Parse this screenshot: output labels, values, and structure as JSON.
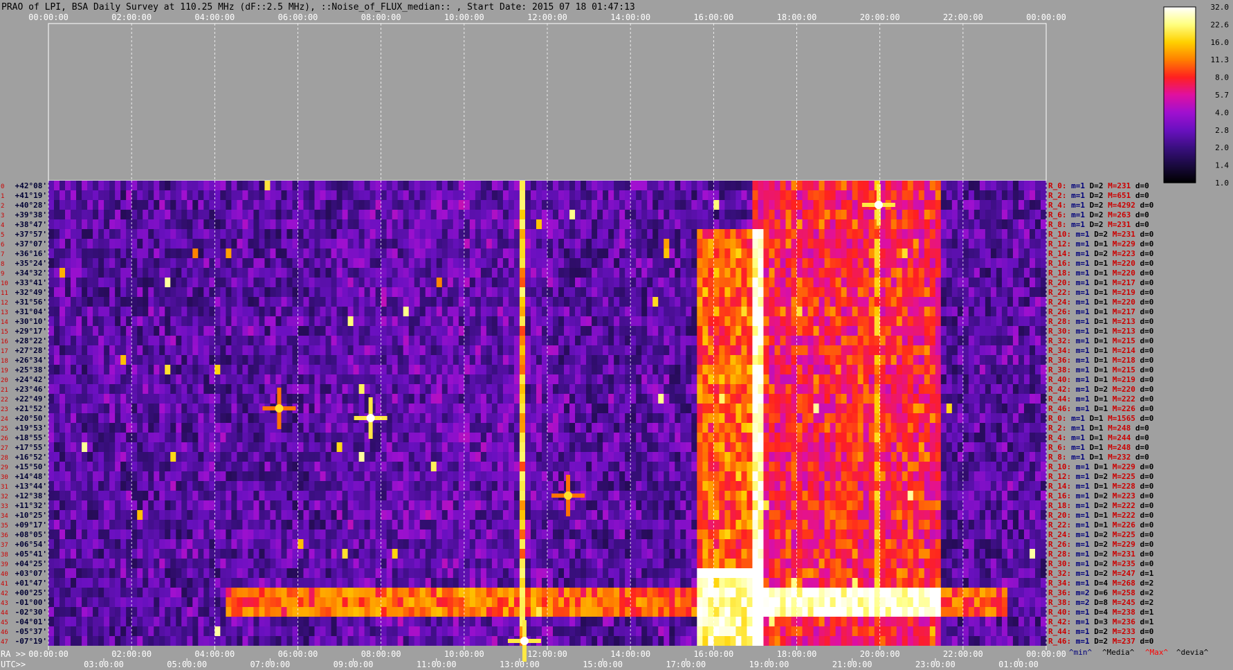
{
  "chart_data": {
    "type": "heatmap",
    "title": "PRAO of LPI, BSA Daily Survey at 110.25 MHz (dF::2.5 MHz), ::Noise_of_FLUX_median:: , Start Date: 2015 07 18 01:47:13",
    "top_time_ticks": [
      "00:00:00",
      "02:00:00",
      "04:00:00",
      "06:00:00",
      "08:00:00",
      "10:00:00",
      "12:00:00",
      "14:00:00",
      "16:00:00",
      "18:00:00",
      "20:00:00",
      "22:00:00",
      "00:00:00"
    ],
    "ra_axis_prefix": "RA >>",
    "ra_ticks": [
      "00:00:00",
      "02:00:00",
      "04:00:00",
      "06:00:00",
      "08:00:00",
      "10:00:00",
      "12:00:00",
      "14:00:00",
      "16:00:00",
      "18:00:00",
      "20:00:00",
      "22:00:00",
      "00:00:00"
    ],
    "utc_axis_prefix": "UTC>>",
    "utc_ticks": [
      "03:00:00",
      "05:00:00",
      "07:00:00",
      "09:00:00",
      "11:00:00",
      "13:00:00",
      "15:00:00",
      "17:00:00",
      "19:00:00",
      "21:00:00",
      "23:00:00",
      "01:00:00"
    ],
    "beam_indices": [
      "0",
      "1",
      "2",
      "3",
      "4",
      "5",
      "6",
      "7",
      "8",
      "9",
      "10",
      "11",
      "12",
      "13",
      "14",
      "15",
      "16",
      "17",
      "18",
      "19",
      "20",
      "21",
      "22",
      "23",
      "24",
      "25",
      "26",
      "27",
      "28",
      "29",
      "30",
      "31",
      "32",
      "33",
      "34",
      "35",
      "36",
      "37",
      "38",
      "39",
      "40",
      "41",
      "42",
      "43",
      "44",
      "45",
      "46",
      "47",
      "0",
      "1",
      "2",
      "3",
      "4",
      "5",
      "6",
      "7",
      "8",
      "9",
      "10",
      "11",
      "12",
      "13",
      "14",
      "15",
      "16",
      "17",
      "18",
      "19",
      "20",
      "21",
      "22",
      "23",
      "24",
      "25",
      "26",
      "27",
      "28",
      "29",
      "30",
      "31",
      "32",
      "33",
      "34",
      "35",
      "36",
      "37",
      "38",
      "39",
      "40",
      "41",
      "42",
      "43",
      "44",
      "45",
      "46",
      "47"
    ],
    "declinations": [
      "+42°08'",
      "+41°19'",
      "+40°28'",
      "+39°38'",
      "+38°47'",
      "+37°57'",
      "+37°07'",
      "+36°16'",
      "+35°24'",
      "+34°32'",
      "+33°41'",
      "+32°49'",
      "+31°56'",
      "+31°04'",
      "+30°10'",
      "+29°17'",
      "+28°22'",
      "+27°28'",
      "+26°34'",
      "+25°38'",
      "+24°42'",
      "+23°46'",
      "+22°49'",
      "+21°52'",
      "+20°50'",
      "+19°53'",
      "+18°55'",
      "+17°55'",
      "+16°52'",
      "+15°50'",
      "+14°48'",
      "+13°44'",
      "+12°38'",
      "+11°32'",
      "+10°25'",
      "+09°17'",
      "+08°05'",
      "+06°54'",
      "+05°41'",
      "+04°25'",
      "+03°07'",
      "+01°47'",
      "+00°25'",
      "-01°00'",
      "-02°30'",
      "-04°01'",
      "-05°37'",
      "-07°19'"
    ],
    "row_stats": [
      {
        "label": "R_0:",
        "m": "1",
        "D": "2",
        "M": "231",
        "d": "0"
      },
      {
        "label": "R_2:",
        "m": "1",
        "D": "2",
        "M": "651",
        "d": "0"
      },
      {
        "label": "R_4:",
        "m": "1",
        "D": "2",
        "M": "4292",
        "d": "0"
      },
      {
        "label": "R_6:",
        "m": "1",
        "D": "2",
        "M": "263",
        "d": "0"
      },
      {
        "label": "R_8:",
        "m": "1",
        "D": "2",
        "M": "231",
        "d": "0"
      },
      {
        "label": "R_10:",
        "m": "1",
        "D": "2",
        "M": "231",
        "d": "0"
      },
      {
        "label": "R_12:",
        "m": "1",
        "D": "1",
        "M": "229",
        "d": "0"
      },
      {
        "label": "R_14:",
        "m": "1",
        "D": "2",
        "M": "223",
        "d": "0"
      },
      {
        "label": "R_16:",
        "m": "1",
        "D": "1",
        "M": "220",
        "d": "0"
      },
      {
        "label": "R_18:",
        "m": "1",
        "D": "1",
        "M": "220",
        "d": "0"
      },
      {
        "label": "R_20:",
        "m": "1",
        "D": "1",
        "M": "217",
        "d": "0"
      },
      {
        "label": "R_22:",
        "m": "1",
        "D": "1",
        "M": "219",
        "d": "0"
      },
      {
        "label": "R_24:",
        "m": "1",
        "D": "1",
        "M": "220",
        "d": "0"
      },
      {
        "label": "R_26:",
        "m": "1",
        "D": "1",
        "M": "217",
        "d": "0"
      },
      {
        "label": "R_28:",
        "m": "1",
        "D": "1",
        "M": "213",
        "d": "0"
      },
      {
        "label": "R_30:",
        "m": "1",
        "D": "1",
        "M": "213",
        "d": "0"
      },
      {
        "label": "R_32:",
        "m": "1",
        "D": "1",
        "M": "215",
        "d": "0"
      },
      {
        "label": "R_34:",
        "m": "1",
        "D": "1",
        "M": "214",
        "d": "0"
      },
      {
        "label": "R_36:",
        "m": "1",
        "D": "1",
        "M": "218",
        "d": "0"
      },
      {
        "label": "R_38:",
        "m": "1",
        "D": "1",
        "M": "215",
        "d": "0"
      },
      {
        "label": "R_40:",
        "m": "1",
        "D": "1",
        "M": "219",
        "d": "0"
      },
      {
        "label": "R_42:",
        "m": "1",
        "D": "2",
        "M": "220",
        "d": "0"
      },
      {
        "label": "R_44:",
        "m": "1",
        "D": "1",
        "M": "222",
        "d": "0"
      },
      {
        "label": "R_46:",
        "m": "1",
        "D": "1",
        "M": "226",
        "d": "0"
      },
      {
        "label": "R_0:",
        "m": "1",
        "D": "1",
        "M": "1565",
        "d": "0"
      },
      {
        "label": "R_2:",
        "m": "1",
        "D": "1",
        "M": "248",
        "d": "0"
      },
      {
        "label": "R_4:",
        "m": "1",
        "D": "1",
        "M": "244",
        "d": "0"
      },
      {
        "label": "R_6:",
        "m": "1",
        "D": "1",
        "M": "248",
        "d": "0"
      },
      {
        "label": "R_8:",
        "m": "1",
        "D": "1",
        "M": "232",
        "d": "0"
      },
      {
        "label": "R_10:",
        "m": "1",
        "D": "1",
        "M": "229",
        "d": "0"
      },
      {
        "label": "R_12:",
        "m": "1",
        "D": "2",
        "M": "225",
        "d": "0"
      },
      {
        "label": "R_14:",
        "m": "1",
        "D": "1",
        "M": "228",
        "d": "0"
      },
      {
        "label": "R_16:",
        "m": "1",
        "D": "2",
        "M": "223",
        "d": "0"
      },
      {
        "label": "R_18:",
        "m": "1",
        "D": "2",
        "M": "222",
        "d": "0"
      },
      {
        "label": "R_20:",
        "m": "1",
        "D": "1",
        "M": "222",
        "d": "0"
      },
      {
        "label": "R_22:",
        "m": "1",
        "D": "1",
        "M": "226",
        "d": "0"
      },
      {
        "label": "R_24:",
        "m": "1",
        "D": "2",
        "M": "225",
        "d": "0"
      },
      {
        "label": "R_26:",
        "m": "1",
        "D": "2",
        "M": "229",
        "d": "0"
      },
      {
        "label": "R_28:",
        "m": "1",
        "D": "2",
        "M": "231",
        "d": "0"
      },
      {
        "label": "R_30:",
        "m": "1",
        "D": "2",
        "M": "235",
        "d": "0"
      },
      {
        "label": "R_32:",
        "m": "1",
        "D": "2",
        "M": "247",
        "d": "1"
      },
      {
        "label": "R_34:",
        "m": "1",
        "D": "4",
        "M": "268",
        "d": "2"
      },
      {
        "label": "R_36:",
        "m": "2",
        "D": "6",
        "M": "258",
        "d": "2"
      },
      {
        "label": "R_38:",
        "m": "2",
        "D": "8",
        "M": "245",
        "d": "2"
      },
      {
        "label": "R_40:",
        "m": "1",
        "D": "4",
        "M": "238",
        "d": "1"
      },
      {
        "label": "R_42:",
        "m": "1",
        "D": "3",
        "M": "236",
        "d": "1"
      },
      {
        "label": "R_44:",
        "m": "1",
        "D": "2",
        "M": "233",
        "d": "0"
      },
      {
        "label": "R_46:",
        "m": "1",
        "D": "2",
        "M": "237",
        "d": "0"
      }
    ],
    "stat_keys": {
      "m": "m=",
      "D": "D=",
      "M": "M=",
      "d": "d="
    },
    "stats_legend": [
      "^min^",
      "^Media^",
      "^Max^",
      "^devia^"
    ],
    "stats_legend_colors": [
      "#00007a",
      "#000000",
      "#ff0000",
      "#000000"
    ],
    "colorbar_ticks": [
      "32.0",
      "22.6",
      "16.0",
      "11.3",
      "8.0",
      "5.7",
      "4.0",
      "2.8",
      "2.0",
      "1.4",
      "1.0"
    ],
    "colormap": [
      "#000000",
      "#1a0a40",
      "#3a0f80",
      "#6a10c0",
      "#a010d0",
      "#e010a0",
      "#ff2020",
      "#ff8000",
      "#ffd000",
      "#ffff80",
      "#ffffff"
    ],
    "ra_hour_range": [
      0,
      24
    ],
    "background_level": 1.6,
    "noise_spread": 1.8,
    "features": [
      {
        "kind": "band",
        "ra_from": 4.2,
        "ra_to": 23.0,
        "dec_from": "+00°25'",
        "dec_to": "-02°30'",
        "level": 12
      },
      {
        "kind": "band",
        "ra_from": 15.6,
        "ra_to": 17.2,
        "dec_from": "+03°07'",
        "dec_to": "-07°19'",
        "level": 30
      },
      {
        "kind": "band",
        "ra_from": 15.6,
        "ra_to": 17.2,
        "dec_from": "+37°57'",
        "dec_to": "+03°07'",
        "level": 4
      },
      {
        "kind": "band",
        "ra_from": 17.0,
        "ra_to": 21.5,
        "dec_from": "+42°08'",
        "dec_to": "-07°19'",
        "level": 3
      },
      {
        "kind": "band",
        "ra_from": 7.0,
        "ra_to": 12.2,
        "dec_from": "+42°08'",
        "dec_to": "-07°19'",
        "level": 1.1
      },
      {
        "kind": "source",
        "ra": 19.97,
        "dec": "+40°28'",
        "level": 32
      },
      {
        "kind": "source",
        "ra": 7.75,
        "dec": "+20°50'",
        "level": 32
      },
      {
        "kind": "source",
        "ra": 5.55,
        "dec": "+21°52'",
        "level": 18
      },
      {
        "kind": "source",
        "ra": 12.5,
        "dec": "+12°38'",
        "level": 18
      },
      {
        "kind": "source",
        "ra": 11.45,
        "dec": "-07°19'",
        "level": 32
      },
      {
        "kind": "streak",
        "ra": 11.4,
        "level": 22
      },
      {
        "kind": "streak",
        "ra": 19.95,
        "level": 18
      },
      {
        "kind": "arc",
        "from_ra": 19.0,
        "from_dec": "+03°07'",
        "to_ra": 19.8,
        "to_dec": "+31°04'",
        "level": 10
      }
    ],
    "grid": true,
    "colorbar": "right"
  }
}
